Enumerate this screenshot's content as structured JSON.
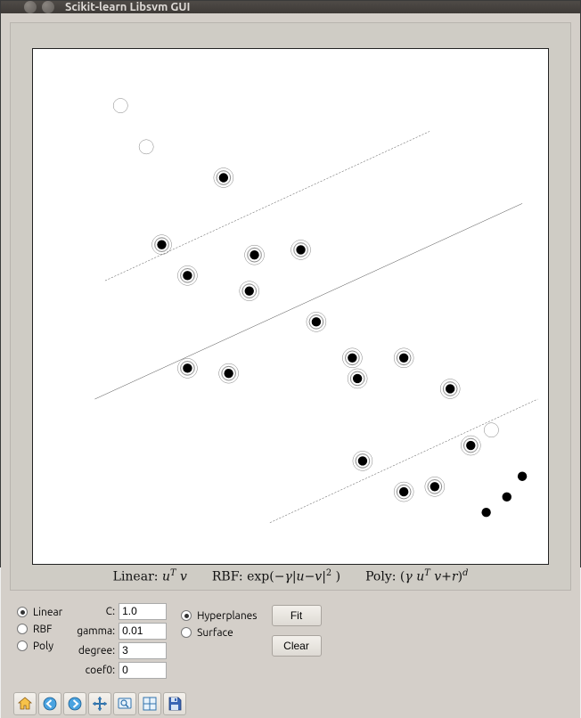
{
  "window": {
    "title": "Scikit-learn Libsvm GUI"
  },
  "formulas": {
    "linear_label": "Linear:",
    "rbf_label": "RBF:",
    "poly_label": "Poly:"
  },
  "kernel_radios": {
    "linear": "Linear",
    "rbf": "RBF",
    "poly": "Poly",
    "selected": "linear"
  },
  "params": {
    "c_label": "C:",
    "c_value": "1.0",
    "gamma_label": "gamma:",
    "gamma_value": "0.01",
    "degree_label": "degree:",
    "degree_value": "3",
    "coef0_label": "coef0:",
    "coef0_value": "0"
  },
  "view_radios": {
    "hyperplanes": "Hyperplanes",
    "surface": "Surface",
    "selected": "hyperplanes"
  },
  "actions": {
    "fit": "Fit",
    "clear": "Clear"
  },
  "toolbar_icons": {
    "home": "home-icon",
    "back": "back-icon",
    "forward": "forward-icon",
    "pan": "pan-icon",
    "zoom": "zoom-icon",
    "subplots": "subplots-icon",
    "save": "save-icon"
  },
  "chart_data": {
    "type": "scatter",
    "title": "",
    "xlabel": "",
    "ylabel": "",
    "xlim": [
      0,
      100
    ],
    "ylim": [
      0,
      100
    ],
    "series": [
      {
        "name": "class-white",
        "marker": "open-circle",
        "points": [
          [
            17,
            89
          ],
          [
            22,
            81
          ],
          [
            37,
            75
          ],
          [
            25,
            62
          ],
          [
            30,
            56
          ],
          [
            42,
            53
          ],
          [
            43,
            60
          ],
          [
            52,
            61
          ],
          [
            30,
            38
          ],
          [
            38,
            37
          ],
          [
            55,
            47
          ],
          [
            62,
            40
          ],
          [
            63,
            36
          ],
          [
            72,
            40
          ],
          [
            81,
            34
          ],
          [
            64,
            20
          ],
          [
            85,
            23
          ],
          [
            78,
            15
          ],
          [
            72,
            14
          ],
          [
            89,
            26
          ]
        ]
      },
      {
        "name": "class-black",
        "marker": "filled-circle",
        "points": [
          [
            37,
            75
          ],
          [
            25,
            62
          ],
          [
            30,
            56
          ],
          [
            42,
            53
          ],
          [
            43,
            60
          ],
          [
            52,
            61
          ],
          [
            30,
            38
          ],
          [
            38,
            37
          ],
          [
            55,
            47
          ],
          [
            62,
            40
          ],
          [
            63,
            36
          ],
          [
            72,
            40
          ],
          [
            81,
            34
          ],
          [
            64,
            20
          ],
          [
            85,
            23
          ],
          [
            78,
            15
          ],
          [
            72,
            14
          ],
          [
            88,
            10
          ],
          [
            92,
            13
          ],
          [
            95,
            17
          ]
        ]
      },
      {
        "name": "support-vectors",
        "marker": "double-ring",
        "points": [
          [
            37,
            75
          ],
          [
            25,
            62
          ],
          [
            30,
            56
          ],
          [
            42,
            53
          ],
          [
            43,
            60
          ],
          [
            52,
            61
          ],
          [
            30,
            38
          ],
          [
            38,
            37
          ],
          [
            55,
            47
          ],
          [
            62,
            40
          ],
          [
            63,
            36
          ],
          [
            72,
            40
          ],
          [
            81,
            34
          ],
          [
            64,
            20
          ],
          [
            85,
            23
          ],
          [
            78,
            15
          ],
          [
            72,
            14
          ]
        ]
      }
    ],
    "lines": [
      {
        "name": "decision-boundary",
        "style": "solid",
        "p1": [
          12,
          32
        ],
        "p2": [
          95,
          70
        ]
      },
      {
        "name": "margin-upper",
        "style": "dashed",
        "p1": [
          14,
          55
        ],
        "p2": [
          77,
          84
        ]
      },
      {
        "name": "margin-lower",
        "style": "dashed",
        "p1": [
          46,
          8
        ],
        "p2": [
          98,
          32
        ]
      }
    ]
  }
}
